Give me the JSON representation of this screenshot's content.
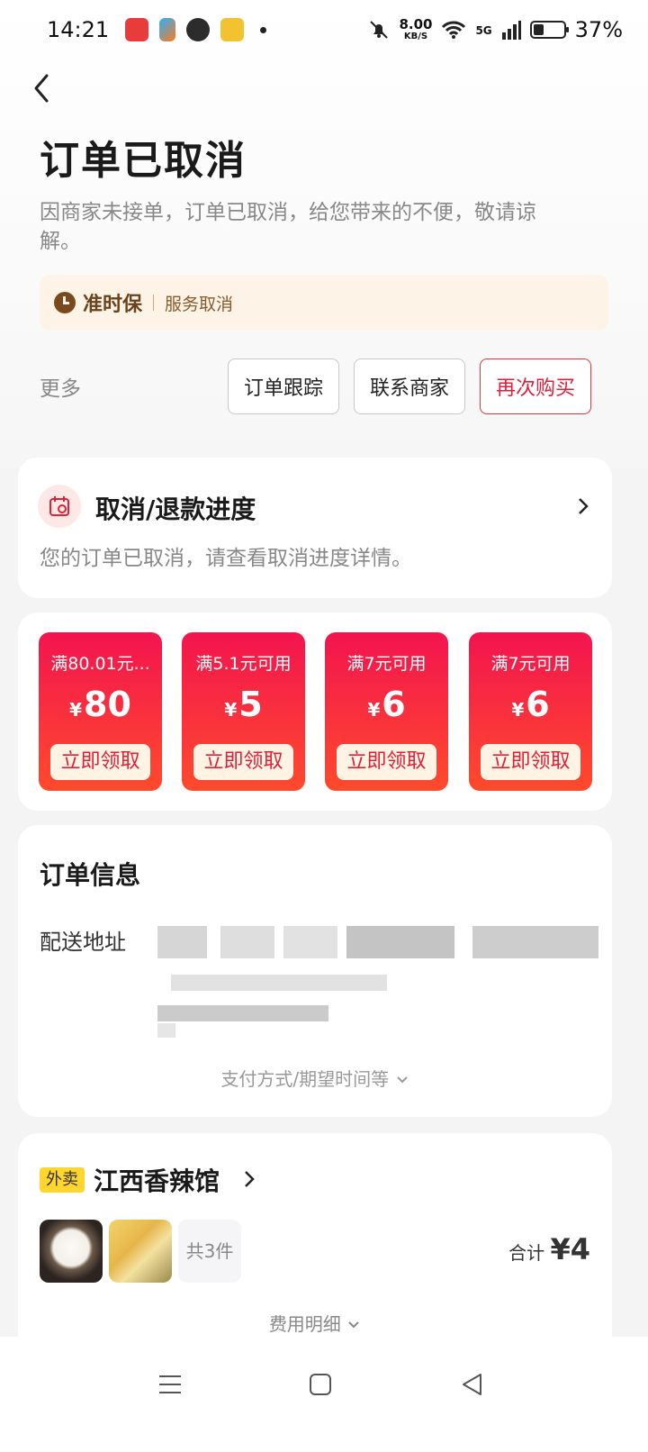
{
  "status_bar": {
    "time": "14:21",
    "speed_value": "8.00",
    "speed_unit": "KB/S",
    "network": "5G",
    "battery": "37%",
    "battery_level": 0.37
  },
  "header": {
    "title": "订单已取消",
    "subtitle": "因商家未接单，订单已取消，给您带来的不便，敬请谅解。",
    "guarantee_name": "准时保",
    "guarantee_desc": "服务取消",
    "more_label": "更多",
    "track_button": "订单跟踪",
    "contact_button": "联系商家",
    "rebuy_button": "再次购买"
  },
  "refund": {
    "title": "取消/退款进度",
    "desc": "您的订单已取消，请查看取消进度详情。"
  },
  "coupons": [
    {
      "condition": "满80.01元...",
      "symbol": "¥",
      "amount": "80",
      "claim": "立即领取"
    },
    {
      "condition": "满5.1元可用",
      "symbol": "¥",
      "amount": "5",
      "claim": "立即领取"
    },
    {
      "condition": "满7元可用",
      "symbol": "¥",
      "amount": "6",
      "claim": "立即领取"
    },
    {
      "condition": "满7元可用",
      "symbol": "¥",
      "amount": "6",
      "claim": "立即领取"
    }
  ],
  "order_info": {
    "title": "订单信息",
    "address_label": "配送地址",
    "more_info": "支付方式/期望时间等"
  },
  "shop": {
    "tag": "外卖",
    "name": "江西香辣馆",
    "item_count": "共3件",
    "total_label": "合计",
    "total_amount": "¥4",
    "fee_detail": "费用明细"
  },
  "colors": {
    "accent": "#e0203a",
    "coupon_top": "#f3144f",
    "coupon_bottom": "#ff4a2c",
    "guarantee_bg": "#fdf4e7",
    "tag_bg": "#ffd62e"
  },
  "icons": [
    "back-arrow-icon",
    "clock-icon",
    "calendar-cancel-icon",
    "chevron-right-icon",
    "chevron-down-icon",
    "menu-icon",
    "home-icon",
    "back-triangle-icon"
  ]
}
